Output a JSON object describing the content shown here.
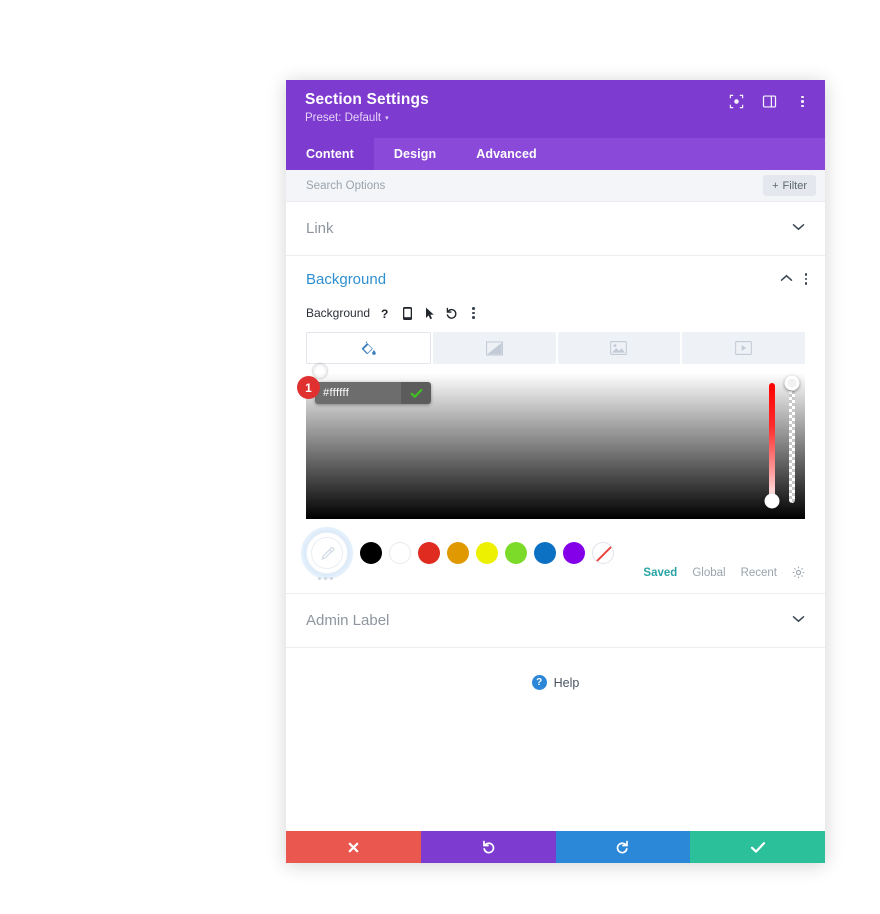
{
  "window": {
    "title": "Section Settings",
    "preset_label": "Preset: Default",
    "preset_caret": "▾",
    "header_icons": [
      {
        "name": "focus-icon",
        "glyph": ""
      },
      {
        "name": "layout-panel-icon",
        "glyph": ""
      },
      {
        "name": "more-options-icon",
        "glyph": ""
      }
    ]
  },
  "tabs": [
    {
      "label": "Content",
      "active": true
    },
    {
      "label": "Design",
      "active": false
    },
    {
      "label": "Advanced",
      "active": false
    }
  ],
  "search": {
    "placeholder": "Search Options",
    "value": "",
    "filter_label": "Filter",
    "filter_plus": "+"
  },
  "sections": {
    "link": {
      "title": "Link",
      "chevron": "⌄"
    },
    "admin_label": {
      "title": "Admin Label",
      "chevron": "⌄"
    }
  },
  "background": {
    "title": "Background",
    "collapse_caret": "⌃",
    "field_label": "Background",
    "field_icons": [
      {
        "name": "help-icon",
        "glyph": "?"
      },
      {
        "name": "responsive-mobile-icon",
        "glyph": ""
      },
      {
        "name": "hover-cursor-icon",
        "glyph": ""
      },
      {
        "name": "reset-undo-icon",
        "glyph": "↺"
      },
      {
        "name": "more-options-icon",
        "glyph": ""
      }
    ],
    "types": [
      {
        "name": "background-color-tab",
        "icon": "paint-bucket-icon",
        "active": true
      },
      {
        "name": "background-gradient-tab",
        "icon": "gradient-icon",
        "active": false
      },
      {
        "name": "background-image-tab",
        "icon": "image-icon",
        "active": false
      },
      {
        "name": "background-video-tab",
        "icon": "video-icon",
        "active": false
      }
    ],
    "picker": {
      "hex_value": "#ffffff",
      "confirm_glyph": "✔",
      "hue_handle_position_pct": 88,
      "alpha_handle_position_pct": 7
    },
    "swatches": [
      {
        "name": "swatch-eyedropper",
        "color": "#ffffff",
        "type": "eyedropper",
        "selected": true
      },
      {
        "name": "swatch-black",
        "color": "#000000",
        "type": "solid"
      },
      {
        "name": "swatch-white",
        "color": "#ffffff",
        "type": "white"
      },
      {
        "name": "swatch-red",
        "color": "#e02b20",
        "type": "solid"
      },
      {
        "name": "swatch-orange",
        "color": "#e09900",
        "type": "solid"
      },
      {
        "name": "swatch-yellow",
        "color": "#edf000",
        "type": "solid"
      },
      {
        "name": "swatch-green",
        "color": "#7cdb28",
        "type": "solid"
      },
      {
        "name": "swatch-blue",
        "color": "#0c71c3",
        "type": "solid"
      },
      {
        "name": "swatch-purple",
        "color": "#8300e9",
        "type": "solid"
      },
      {
        "name": "swatch-transparent",
        "color": "transparent",
        "type": "transparent"
      }
    ],
    "palette_links": [
      {
        "label": "Saved",
        "active": true
      },
      {
        "label": "Global",
        "active": false
      },
      {
        "label": "Recent",
        "active": false
      }
    ],
    "settings_gear": "⚙"
  },
  "help": {
    "badge": "?",
    "label": "Help"
  },
  "footer": [
    {
      "name": "cancel-button",
      "glyph": "✖",
      "color": "#e9574f"
    },
    {
      "name": "undo-button",
      "glyph": "↺",
      "color": "#7e3bd0"
    },
    {
      "name": "redo-button",
      "glyph": "↻",
      "color": "#2b87d8"
    },
    {
      "name": "save-button",
      "glyph": "✔",
      "color": "#2bbf9a"
    }
  ],
  "annotation": {
    "step_number": "1"
  },
  "colors": {
    "header_purple": "#7e3bd0",
    "tabbar_purple": "#8a49d8",
    "accent_blue": "#2f8fd0",
    "saved_teal": "#29a3a3"
  }
}
